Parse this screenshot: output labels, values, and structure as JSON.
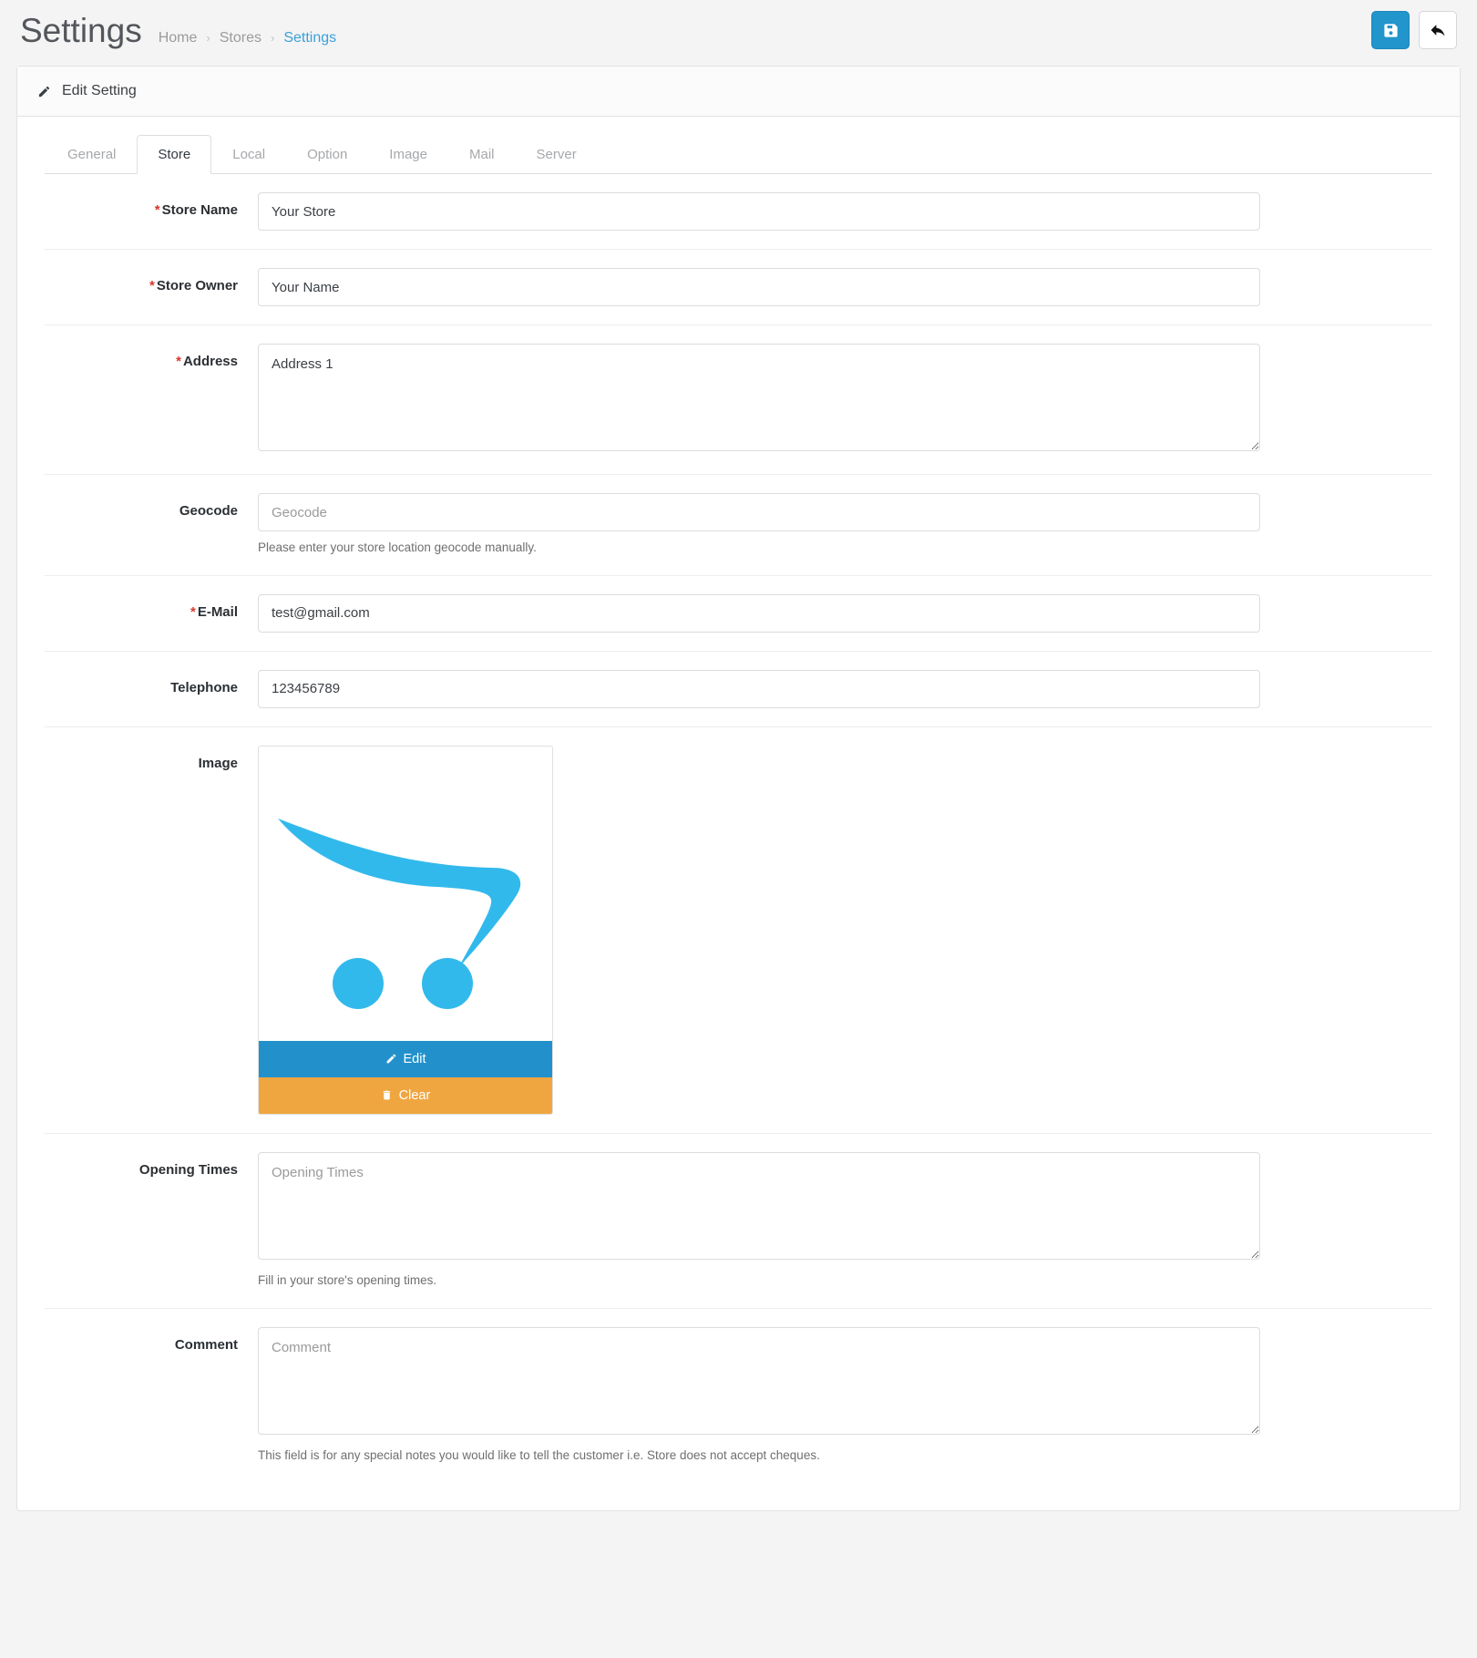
{
  "header": {
    "title": "Settings",
    "breadcrumb": [
      {
        "label": "Home",
        "active": false
      },
      {
        "label": "Stores",
        "active": false
      },
      {
        "label": "Settings",
        "active": true
      }
    ],
    "separator": "›",
    "actions": {
      "save": {
        "name": "save-button",
        "icon": "floppy-disk-icon",
        "color": "#2295cc"
      },
      "back": {
        "name": "back-button",
        "icon": "reply-arrow-icon",
        "color": "#ffffff"
      }
    }
  },
  "panel": {
    "heading": "Edit Setting",
    "heading_icon": "pencil-icon"
  },
  "tabs": [
    {
      "label": "General",
      "active": false
    },
    {
      "label": "Store",
      "active": true
    },
    {
      "label": "Local",
      "active": false
    },
    {
      "label": "Option",
      "active": false
    },
    {
      "label": "Image",
      "active": false
    },
    {
      "label": "Mail",
      "active": false
    },
    {
      "label": "Server",
      "active": false
    }
  ],
  "form": {
    "store_name": {
      "label": "Store Name",
      "required": true,
      "value": "Your Store",
      "placeholder": "Store Name"
    },
    "store_owner": {
      "label": "Store Owner",
      "required": true,
      "value": "Your Name",
      "placeholder": "Store Owner"
    },
    "address": {
      "label": "Address",
      "required": true,
      "value": "Address 1",
      "placeholder": "Address"
    },
    "geocode": {
      "label": "Geocode",
      "required": false,
      "value": "",
      "placeholder": "Geocode",
      "help": "Please enter your store location geocode manually."
    },
    "email": {
      "label": "E-Mail",
      "required": true,
      "value": "test@gmail.com",
      "placeholder": "E-Mail"
    },
    "telephone": {
      "label": "Telephone",
      "required": false,
      "value": "123456789",
      "placeholder": "Telephone"
    },
    "image": {
      "label": "Image",
      "alt": "opencart-cart-logo",
      "edit_label": "Edit",
      "edit_icon": "pencil-icon",
      "clear_label": "Clear",
      "clear_icon": "trash-icon",
      "logo_color": "#32b9ec"
    },
    "opening_times": {
      "label": "Opening Times",
      "required": false,
      "value": "",
      "placeholder": "Opening Times",
      "help": "Fill in your store's opening times."
    },
    "comment": {
      "label": "Comment",
      "required": false,
      "value": "",
      "placeholder": "Comment",
      "help": "This field is for any special notes you would like to tell the customer i.e. Store does not accept cheques."
    }
  },
  "colors": {
    "page_bg": "#f4f4f4",
    "primary": "#2295cc",
    "warning": "#f0a640",
    "required": "#d9372a",
    "link": "#3aa0d8"
  }
}
